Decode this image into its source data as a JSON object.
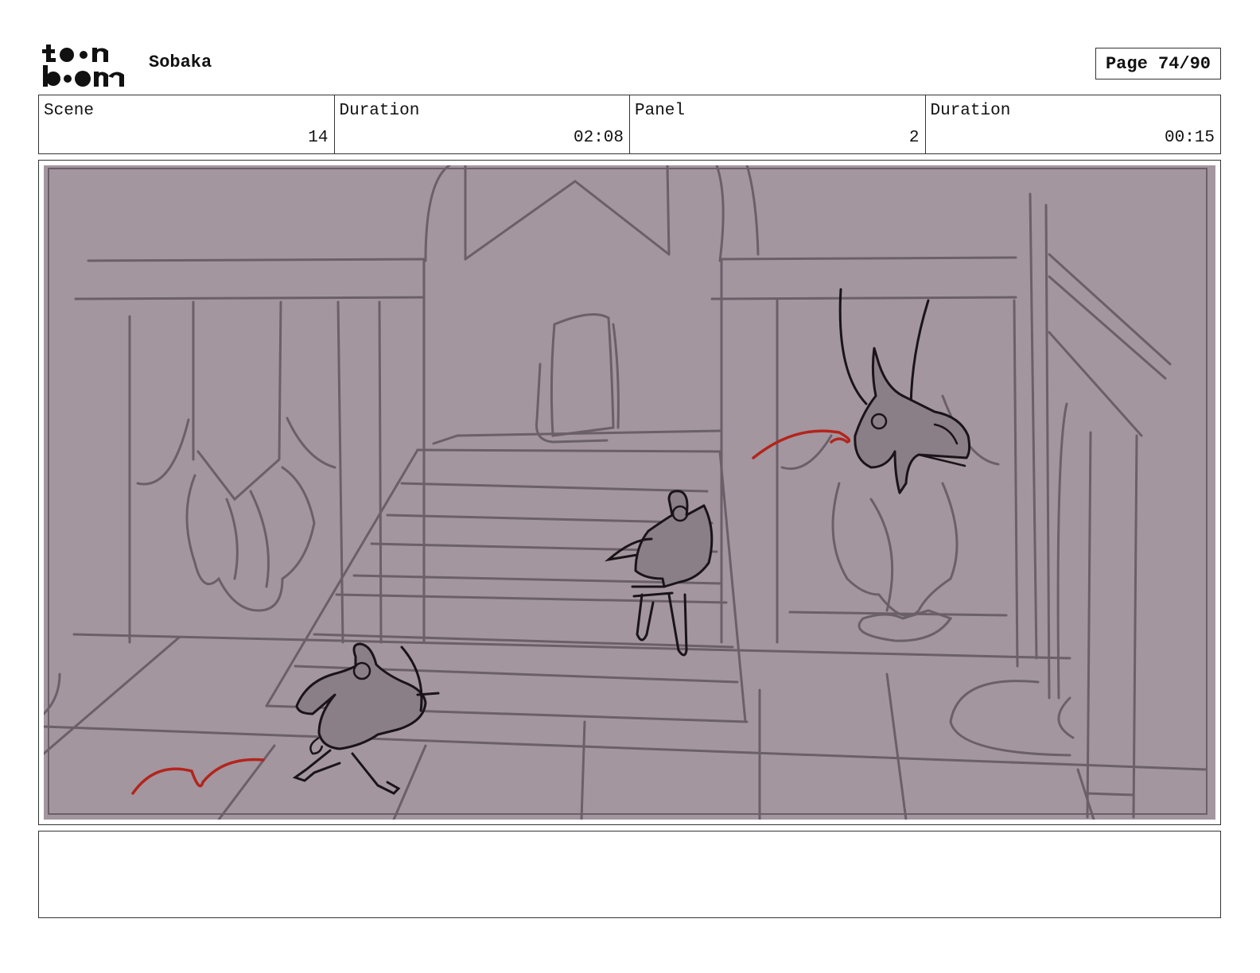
{
  "header": {
    "logo_text": "toon boom",
    "project_title": "Sobaka",
    "page_label": "Page 74/90"
  },
  "info": {
    "scene_label": "Scene",
    "scene_value": "14",
    "scene_duration_label": "Duration",
    "scene_duration_value": "02:08",
    "panel_label": "Panel",
    "panel_value": "2",
    "panel_duration_label": "Duration",
    "panel_duration_value": "00:15"
  },
  "panel": {
    "background_color": "#a3969f",
    "line_color": "#6b5f68",
    "ink_color": "#1a1418",
    "accent_color": "#b3241c"
  },
  "notes": {
    "text": ""
  }
}
